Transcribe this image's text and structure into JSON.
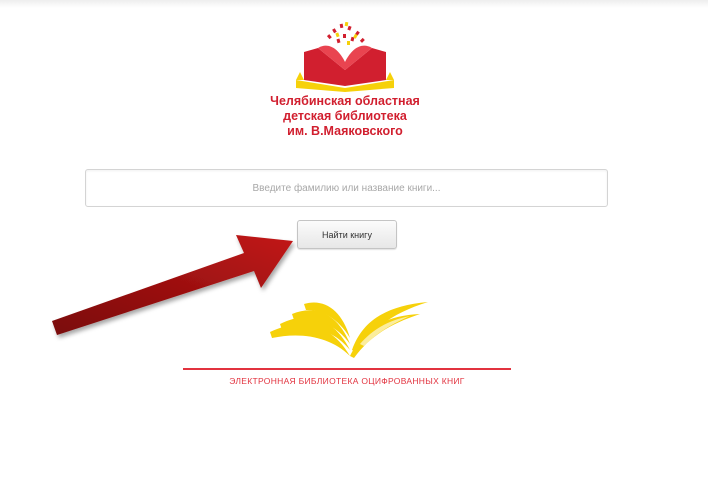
{
  "header": {
    "org_name_line1": "Челябинская областная",
    "org_name_line2": "детская библиотека",
    "org_name_line3": "им. В.Маяковского",
    "logo_icon": "open-book-logo-icon"
  },
  "search": {
    "placeholder": "Введите фамилию или название книги...",
    "value": "",
    "button_label": "Найти книгу"
  },
  "footer": {
    "tagline": "ЭЛЕКТРОННАЯ БИБЛИОТЕКА ОЦИФРОВАННЫХ КНИГ",
    "book_icon": "yellow-open-book-icon"
  },
  "annotation": {
    "arrow_icon": "arrow-pointing-to-search-button-icon"
  },
  "colors": {
    "brand_red": "#d11f2f",
    "brand_yellow": "#f6d10a",
    "arrow": "#8b0d0d"
  }
}
